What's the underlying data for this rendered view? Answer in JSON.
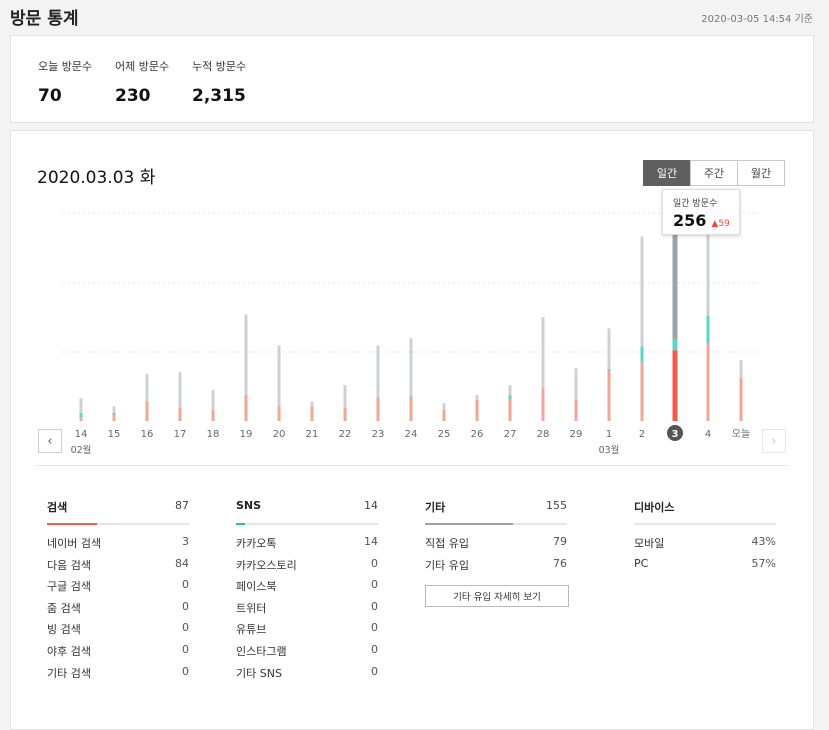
{
  "header": {
    "title": "방문 통계",
    "timestamp": "2020-03-05 14:54 기준"
  },
  "summary": [
    {
      "label": "오늘 방문수",
      "value": "70"
    },
    {
      "label": "어제 방문수",
      "value": "230"
    },
    {
      "label": "누적 방문수",
      "value": "2,315"
    }
  ],
  "chart_header": {
    "date": "2020.03.03 화",
    "tabs": [
      {
        "label": "일간",
        "active": true
      },
      {
        "label": "주간",
        "active": false
      },
      {
        "label": "월간",
        "active": false
      }
    ]
  },
  "tooltip": {
    "label": "일간 방문수",
    "value": "256",
    "diff": "59"
  },
  "nav": {
    "prev": "‹",
    "next": "›"
  },
  "colors": {
    "primary": "#f4a597",
    "selected_primary": "#f05a48",
    "mid": "#5fd3c4",
    "other": "#cdd1d5",
    "selected_other": "#9ca4aa",
    "accent_sns": "#2bbf9a",
    "accent_etc": "#9ba3a6"
  },
  "chart_data": {
    "type": "bar",
    "stacked": true,
    "categories": [
      "14",
      "15",
      "16",
      "17",
      "18",
      "19",
      "20",
      "21",
      "22",
      "23",
      "24",
      "25",
      "26",
      "27",
      "28",
      "29",
      "1",
      "2",
      "3",
      "4",
      "오늘"
    ],
    "month_labels": [
      {
        "index": 0,
        "label": "02월"
      },
      {
        "index": 16,
        "label": "03월"
      }
    ],
    "selected_index": 18,
    "series": [
      {
        "key": "primary",
        "values": [
          4,
          8,
          24,
          16,
          14,
          32,
          18,
          18,
          16,
          30,
          28,
          14,
          26,
          26,
          40,
          26,
          62,
          72,
          87,
          95,
          53
        ]
      },
      {
        "key": "mid",
        "values": [
          6,
          2,
          0,
          0,
          0,
          0,
          0,
          0,
          0,
          0,
          2,
          0,
          0,
          6,
          0,
          0,
          2,
          20,
          14,
          35,
          0
        ]
      },
      {
        "key": "other",
        "values": [
          18,
          8,
          34,
          44,
          24,
          99,
          75,
          6,
          28,
          63,
          72,
          8,
          6,
          12,
          88,
          39,
          50,
          135,
          155,
          110,
          22
        ]
      }
    ],
    "ylim": [
      0,
      256
    ],
    "grid": true
  },
  "stats": {
    "search": {
      "title": "검색",
      "total": "87",
      "rows": [
        {
          "label": "네이버 검색",
          "value": "3"
        },
        {
          "label": "다음 검색",
          "value": "84"
        },
        {
          "label": "구글 검색",
          "value": "0"
        },
        {
          "label": "줌 검색",
          "value": "0"
        },
        {
          "label": "빙 검색",
          "value": "0"
        },
        {
          "label": "야후 검색",
          "value": "0"
        },
        {
          "label": "기타 검색",
          "value": "0"
        }
      ]
    },
    "sns": {
      "title": "SNS",
      "total": "14",
      "rows": [
        {
          "label": "카카오톡",
          "value": "14"
        },
        {
          "label": "카카오스토리",
          "value": "0"
        },
        {
          "label": "페이스북",
          "value": "0"
        },
        {
          "label": "트위터",
          "value": "0"
        },
        {
          "label": "유튜브",
          "value": "0"
        },
        {
          "label": "인스타그램",
          "value": "0"
        },
        {
          "label": "기타 SNS",
          "value": "0"
        }
      ]
    },
    "etc": {
      "title": "기타",
      "total": "155",
      "rows": [
        {
          "label": "직접 유입",
          "value": "79"
        },
        {
          "label": "기타 유입",
          "value": "76"
        }
      ],
      "detail_button": "기타 유입 자세히 보기"
    },
    "device": {
      "title": "디바이스",
      "rows": [
        {
          "label": "모바일",
          "value": "43%"
        },
        {
          "label": "PC",
          "value": "57%"
        }
      ]
    }
  }
}
